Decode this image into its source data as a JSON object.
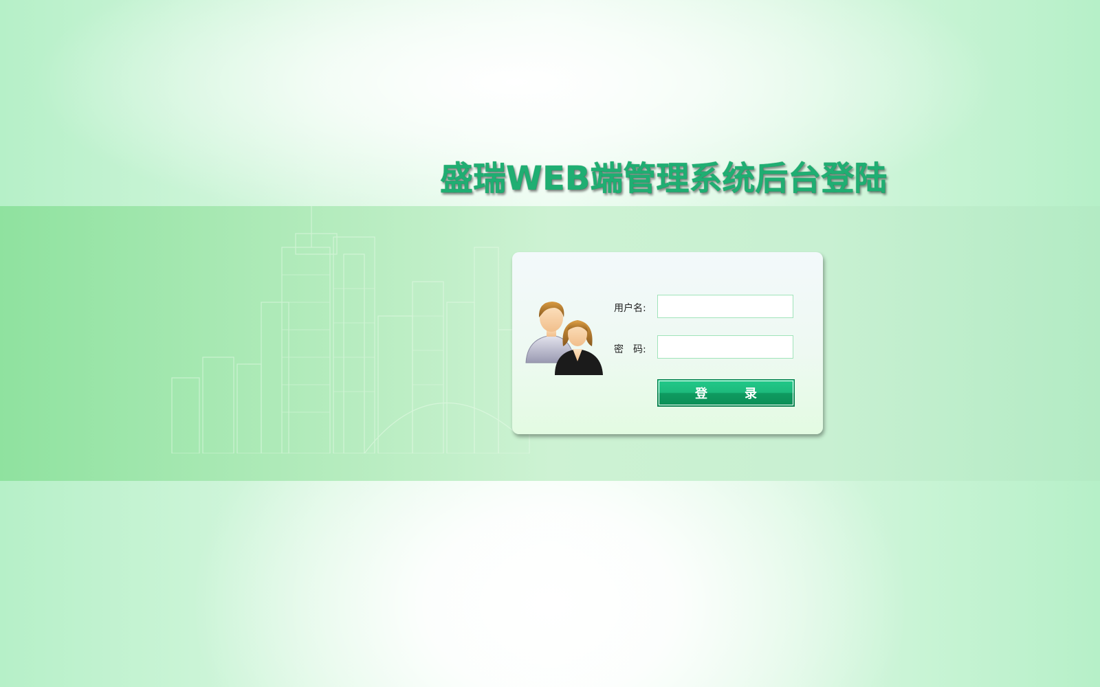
{
  "header": {
    "title": "盛瑞WEB端管理系统后台登陆"
  },
  "login_form": {
    "username_label": "用户名:",
    "username_value": "",
    "password_label": "密　码:",
    "password_value": "",
    "submit_label": "登　录"
  },
  "colors": {
    "accent": "#1fae72",
    "button": "#1dba7c",
    "input_border": "#9fe3b9",
    "band": "#aeeab8"
  },
  "icons": {
    "avatar": "users-icon",
    "background": "city-skyline"
  }
}
